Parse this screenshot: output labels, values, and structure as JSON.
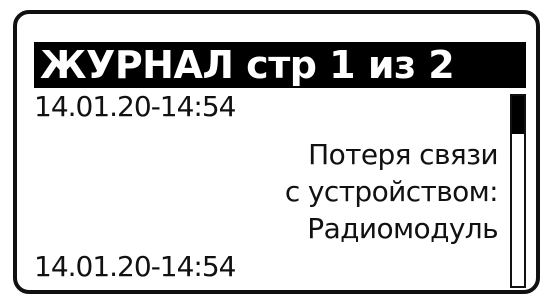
{
  "header": {
    "title": "ЖУРНАЛ стр 1 из 2"
  },
  "log": {
    "entries": [
      {
        "timestamp": "14.01.20-14:54",
        "message_lines": [
          "Потеря связи",
          "с устройством:",
          "Радиомодуль"
        ]
      },
      {
        "timestamp": "14.01.20-14:54"
      }
    ]
  },
  "scrollbar": {
    "position_fraction": 0.0,
    "visible_fraction": 0.2
  },
  "colors": {
    "background": "#ffffff",
    "foreground": "#111111",
    "title_background": "#000000",
    "title_text": "#ffffff"
  }
}
